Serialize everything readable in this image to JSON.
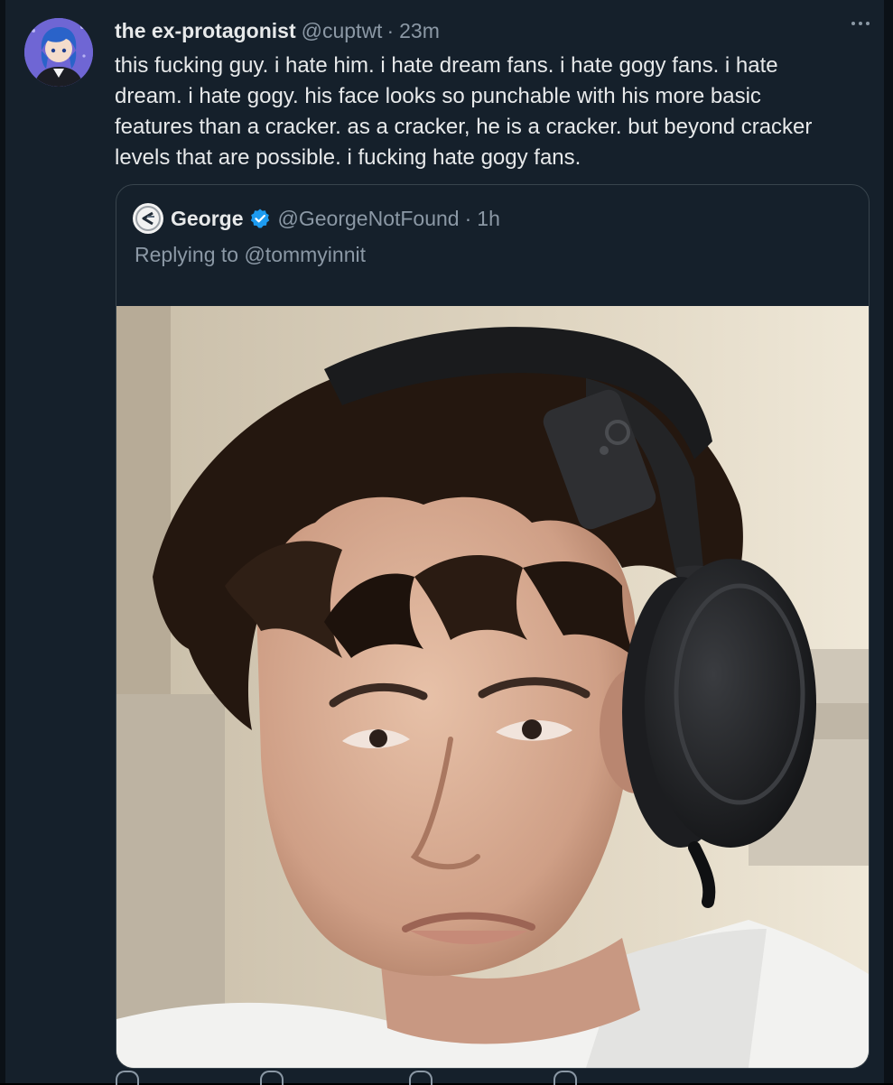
{
  "tweet": {
    "display_name": "the ex-protagonist",
    "handle": "@cuptwt",
    "separator": "·",
    "time": "23m",
    "text": "this fucking guy. i hate him. i hate dream fans. i hate gogy fans. i hate dream. i hate gogy. his face looks so punchable with his more basic features than a cracker. as a cracker, he is a cracker. but beyond cracker levels that are possible. i fucking hate gogy fans.",
    "avatar_icon": "anime-avatar-icon",
    "more_icon": "more-dots-icon"
  },
  "quote": {
    "display_name": "George",
    "handle": "@GeorgeNotFound",
    "separator": "·",
    "time": "1h",
    "reply_text": "Replying to @tommyinnit",
    "avatar_icon": "george-logo-icon",
    "verified_icon": "verified-badge-icon",
    "photo_icon": "headphones-portrait-photo"
  },
  "colors": {
    "background": "#15202b",
    "text_primary": "#e7e9ea",
    "text_secondary": "#8b98a5",
    "border": "#38444d",
    "verified": "#1d9bf0"
  }
}
